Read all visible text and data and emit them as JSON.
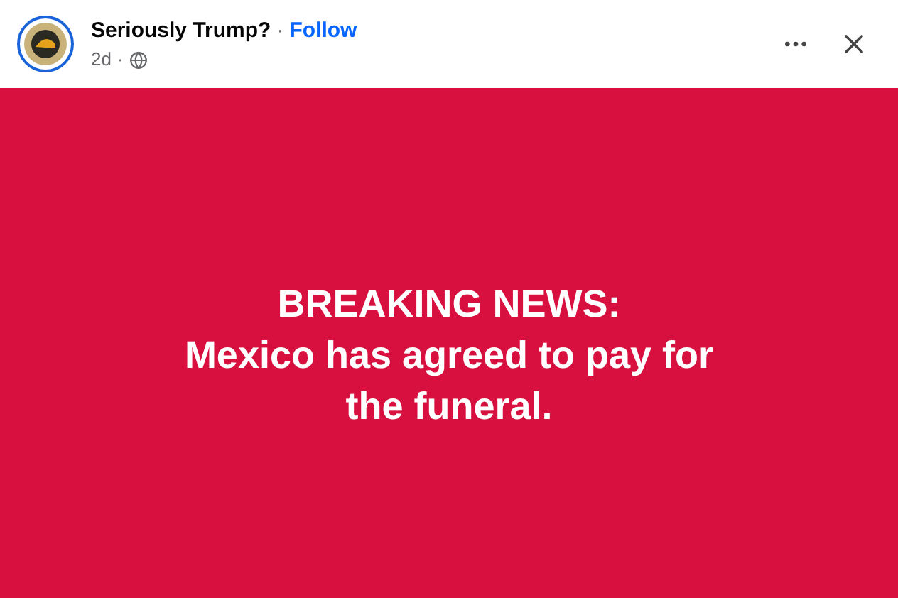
{
  "post": {
    "author": "Seriously Trump?",
    "separator": "·",
    "follow": "Follow",
    "time": "2d",
    "time_separator": "·"
  },
  "card": {
    "color": "#d81040",
    "lines": [
      "BREAKING NEWS:",
      "Mexico has agreed to pay for the funeral."
    ]
  }
}
